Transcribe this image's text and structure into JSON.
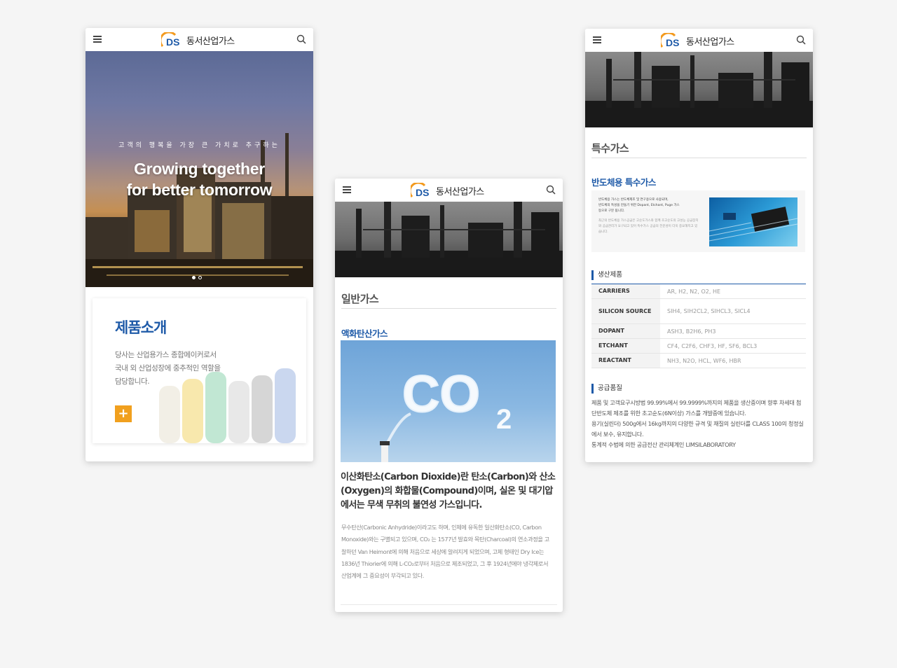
{
  "brand": {
    "name": "동서산업가스"
  },
  "phone1": {
    "hero": {
      "subtitle": "고객의 행복을 가장 큰 가치로 추구하는",
      "title_line1": "Growing together",
      "title_line2": "for better tomorrow",
      "slides": 2,
      "active_slide": 1
    },
    "product_card": {
      "title": "제품소개",
      "desc_line1": "당사는 산업용가스 종합메이커로서",
      "desc_line2": "국내 외 산업성장에 중추적인 역할을",
      "desc_line3": "담당합니다.",
      "plus_label": "+"
    }
  },
  "phone2": {
    "page_title": "일반가스",
    "sub_title": "액화탄산가스",
    "co2_label": "CO",
    "co2_sub": "2",
    "headline": "이산화탄소(Carbon Dioxide)란 탄소(Carbon)와 산소(Oxygen)의 화합물(Compound)이며, 실온 및 대기압에서는 무색 무취의 불연성 가스입니다.",
    "body": "무수탄산(Carbonic Anhydride)이라고도 하며, 인체에 유독한 일산화탄소(CO, Carbon Monoxide)와는 구별되고 있으며, CO₂ 는 1577년 발효와 목탄(Charcoal)의 연소과정을 고찰하던 Van Heimont에 의해 처음으로 세상에 알려지게 되었으며, 고체 형태인 Dry Ice는 1836년 Thiorier에 의해 L-CO₂로부터 처음으로 제조되었고, 그 후 1924년에야 냉각제로서 산업계에 그 중요성이 부각되고 있다."
  },
  "phone3": {
    "page_title": "특수가스",
    "sub_title": "반도체용 특수가스",
    "semi_line1": "반도체용 가스는 반도체제조 및 연구용으로 사용되며,",
    "semi_line2": "반도체의 특성을 만들기 위한 Dopant, Etchant, Puge 가스",
    "semi_line3": "등으로 구분 됩니다.",
    "semi_fine": "최근의 반도체용 가스공급은 고순도가스와 함께 초고순도의 고성능 공급장치와 공급관리가 요구되고 있어 특수가스 공급의 전문성이 더욱 중요해지고 있습니다.",
    "products_heading": "생산제품",
    "products": [
      {
        "key": "CARRIERS",
        "value": "AR, H2, N2, O2, HE"
      },
      {
        "key": "SILICON SOURCE",
        "value": "SIH4, SIH2CL2, SIHCL3, SICL4"
      },
      {
        "key": "DOPANT",
        "value": "ASH3, B2H6, PH3"
      },
      {
        "key": "ETCHANT",
        "value": "CF4, C2F6, CHF3, HF, SF6, BCL3"
      },
      {
        "key": "REACTANT",
        "value": "NH3, N2O, HCL, WF6, HBR"
      }
    ],
    "quality_heading": "공급품질",
    "quality_p1": "제품 및 고객요구시방법 99.99%에서 99.9999%까지의 제품을 생산중이며 향후 차세대 첨단반도체 제조를 위한 초고순도(6N이상) 가스를 개발중에 있습니다.",
    "quality_p2": "용기(실린더) 500g에서 16kg까지의 다양한 규격 및 재질의 실린더를 CLASS 100의 청정실에서 보수, 유지합니다.",
    "quality_p3": "통계적 수법에 의한 공급전산 관리체계인 LIMSILABORATORY"
  },
  "colors": {
    "accent": "#1e5aa8",
    "plus": "#f1a01e",
    "logo_orange": "#f39a1e"
  }
}
